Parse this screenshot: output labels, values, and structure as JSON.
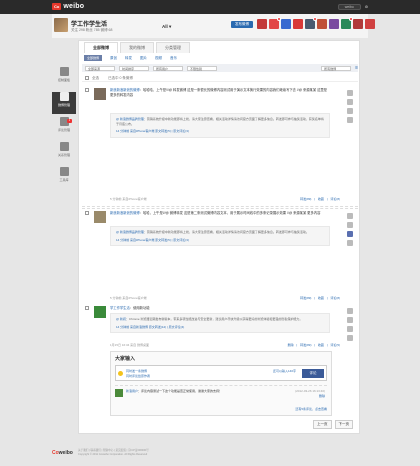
{
  "topbar": {
    "logo_mark": "Co",
    "logo_text": "weibo",
    "search_label": "",
    "user_pill": "weibo"
  },
  "header": {
    "username": "学工作学生活",
    "stats": "关注 298 粉丝 785 微博 68",
    "filter_all": "All",
    "post_button": "发布微博"
  },
  "app_icons": [
    "#c33a3a",
    "#e24848",
    "#3a6ad0",
    "#d83838",
    "#4a5a70",
    "#c05038",
    "#7a4aa0",
    "#2a8a5a",
    "#b03a3a",
    "#d04040"
  ],
  "leftnav": [
    {
      "label": "控制面板",
      "icon": "dashboard-icon"
    },
    {
      "label": "微博管理",
      "icon": "weibo-manage-icon",
      "active": true
    },
    {
      "label": "评论管理",
      "icon": "comment-icon",
      "badge": "1"
    },
    {
      "label": "关系管理",
      "icon": "relation-icon"
    },
    {
      "label": "工具库",
      "icon": "tools-icon"
    }
  ],
  "tabs": [
    "全部微博",
    "我的微博",
    "分类管理"
  ],
  "filters": {
    "chip": "全部微博",
    "links": [
      "原创",
      "转发",
      "图片",
      "视频",
      "音乐"
    ]
  },
  "dropdowns": [
    "全部来源",
    "时间排序",
    "所有用户",
    "不限性别",
    "所有微博"
  ],
  "checkrow": {
    "select_all": "全选",
    "label": "已选中 0 条微博"
  },
  "posts": [
    {
      "author": "新浪新浪新浪的微博",
      "text": "：哈哈哈，上午是!//@ 转发微博 这是一条很长的微博内容测试用于演示文本换行效果的内容我们继续写下去 //@ 来源某某 这里是更多的转发内容",
      "quote_author": "@ 新浪微博品牌管理",
      "quote": "：营销系统升级中新功能即将上线，请大家注意查看，相关活动详情请访问官方页面了解更多信息。转发即可参与抽奖活动，获奖名单将于月底公布。",
      "quote_meta": "14 分钟前  来自iPhone客户端   原文转发(5) | 原文评论(3)",
      "meta_left": "5 分钟前  来自iPhone客户端",
      "meta_right": "转发(89) | 收藏 | 评论(8)"
    },
    {
      "author": "新浪新浪新浪的微博",
      "text": "：哈哈，上午是!//@ 微博转发 这是第二条测试微博内容文本，用于展示时间线中的多条记录展示效果 //@ 来源某某 更多内容",
      "quote_author": "@ 新浪微博品牌管理",
      "quote": "：营销系统升级中新功能即将上线，请大家注意查看，相关活动详情请访问官方页面了解更多信息。转发即可参与抽奖活动。",
      "quote_meta": "14 分钟前  来自iPhone客户端   原文转发(5) | 原文评论(3)",
      "meta_left": "5 分钟前  来自iPhone客户端",
      "meta_right": "转发(89) | 收藏 | 评论(8)"
    },
    {
      "author": "学工作学生活",
      "text": "：使用新功能",
      "quote_author": "@ 新闻",
      "quote": "：Chrome 浏览器近期发布新版本，带来多项性能改进与安全更新，建议用户尽快升级以获得更好的浏览体验和更强的隐私保护能力。",
      "quote_meta": "14 分钟前  来自新浪微博   原文转发(12) | 原文评论(4)",
      "meta_left": "1月15日 16:34  来自 微博桌面",
      "meta_right": "删除 | 转发(89) | 收藏 | 评论(5)"
    }
  ],
  "comment": {
    "title": "大家输入",
    "link1": "同时发一条微博",
    "link2": "同时评论给原作者",
    "link3": "还可以输入140字",
    "submit": "评论",
    "item_author": "新浪用户",
    "item_text": "：评论内容测试一下这个功能是否正常使用，谢谢大家的支持！",
    "item_time": "(2012-03-26 16:13:40)",
    "item_delete": "删除",
    "more": "还有5条评论，点击查看"
  },
  "pager": {
    "prev": "上一页",
    "next": "下一页"
  },
  "footer": {
    "logo_a": "Co",
    "logo_b": "weibo",
    "line1": "关于我们 | 联系我们 | 帮助中心 | 意见反馈 | 京ICP证000000号",
    "line2": "Copyright © 2011 Coweibo Corporation. All Rights Reserved"
  }
}
